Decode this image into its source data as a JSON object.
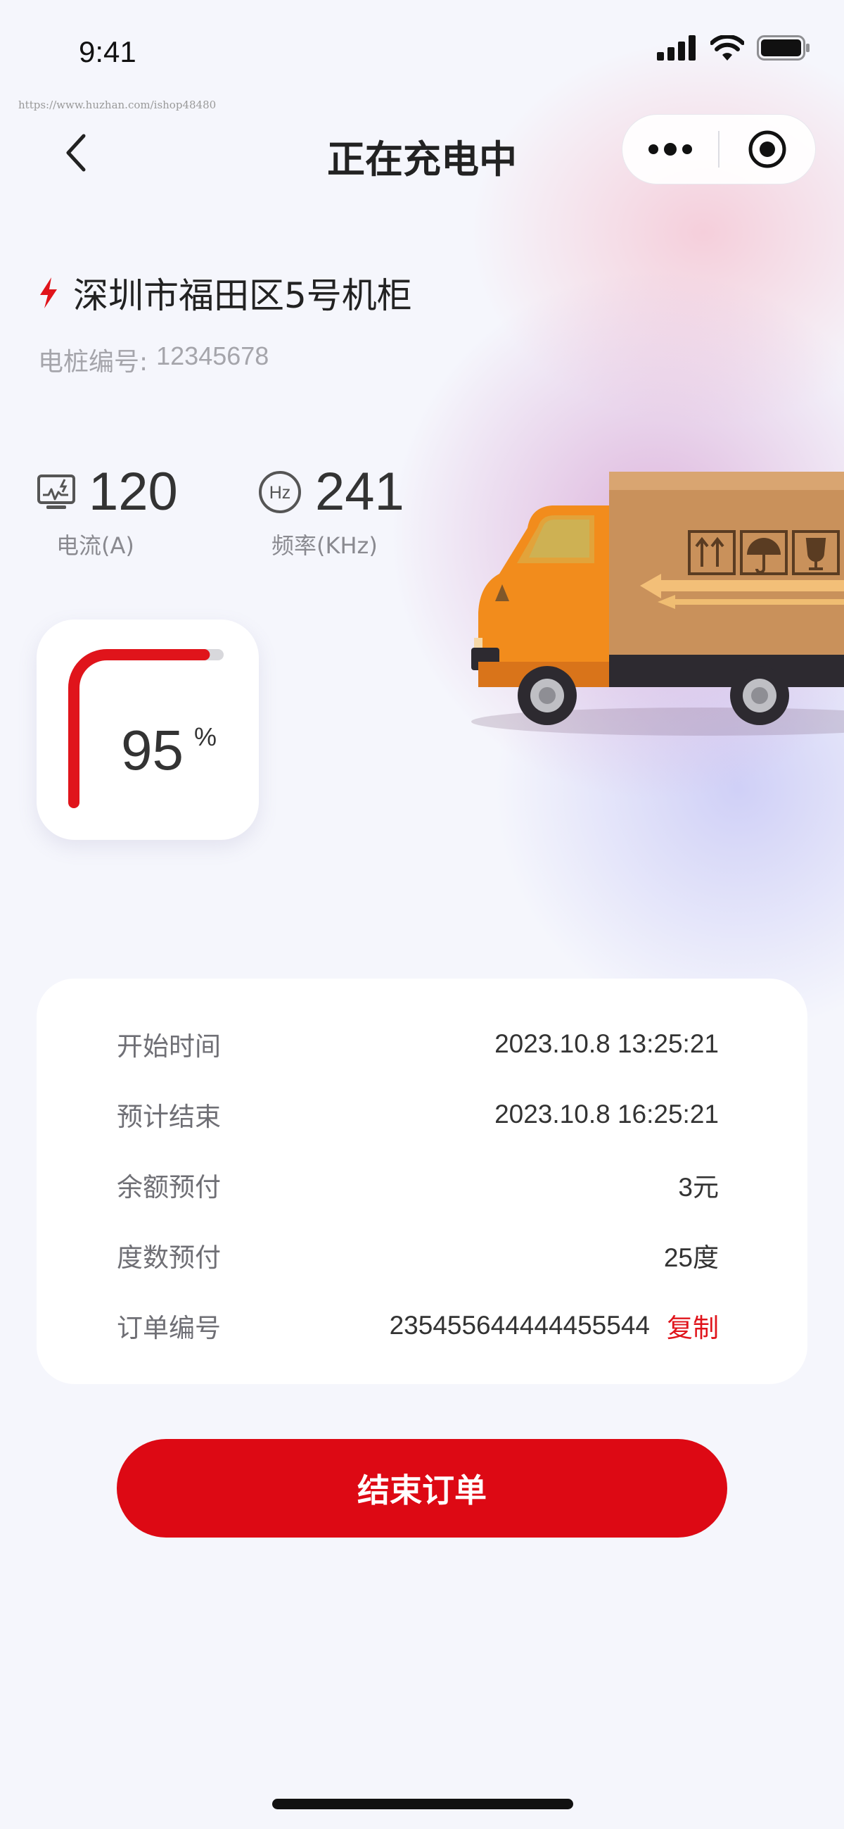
{
  "status_bar": {
    "time": "9:41"
  },
  "watermark": "https://www.huzhan.com/ishop48480",
  "nav": {
    "title": "正在充电中"
  },
  "station": {
    "name": "深圳市福田区5号机柜",
    "pile_label": "电桩编号:",
    "pile_number": "12345678"
  },
  "stats": {
    "current": {
      "value": "120",
      "label": "电流(A)",
      "icon": "monitor-pulse-icon"
    },
    "frequency": {
      "value": "241",
      "label": "频率(KHz)",
      "icon": "hz-icon",
      "icon_text": "Hz"
    }
  },
  "battery": {
    "percent_value": "95",
    "unit": "%",
    "level": 0.95
  },
  "order": {
    "rows": [
      {
        "label": "开始时间",
        "value": "2023.10.8 13:25:21"
      },
      {
        "label": "预计结束",
        "value": "2023.10.8 16:25:21"
      },
      {
        "label": "余额预付",
        "value": "3元"
      },
      {
        "label": "度数预付",
        "value": "25度"
      },
      {
        "label": "订单编号",
        "value": "235455644444455544"
      }
    ],
    "copy_label": "复制"
  },
  "actions": {
    "end_order_label": "结束订单"
  },
  "colors": {
    "accent": "#dd0914",
    "card": "#ffffff",
    "background": "#f5f6fc"
  }
}
